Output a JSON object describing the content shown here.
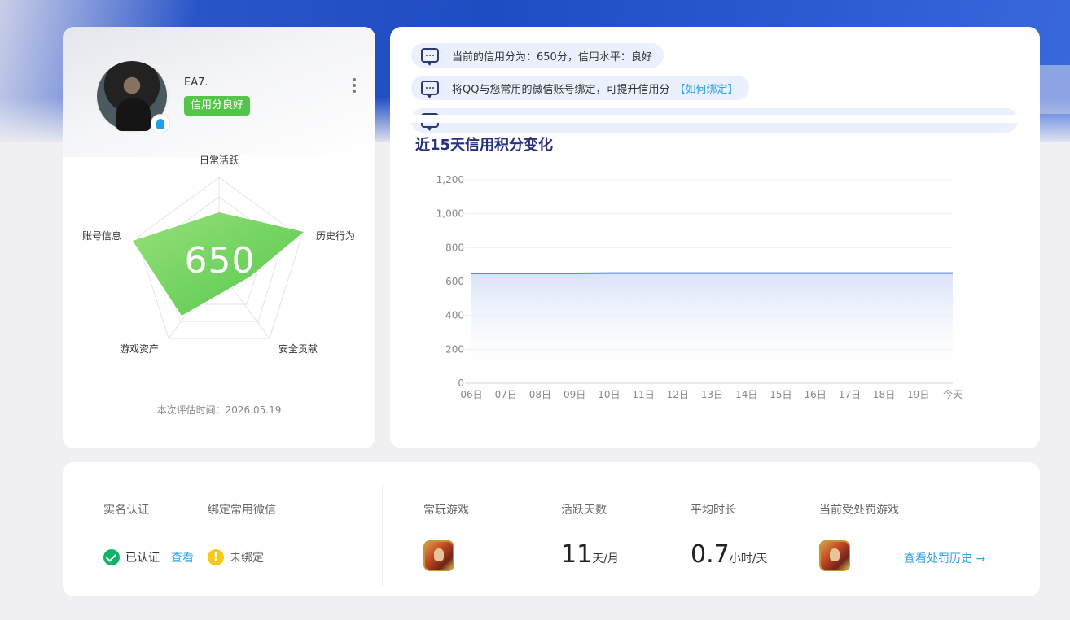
{
  "profile": {
    "username": "EA7.",
    "credit_badge": "信用分良好",
    "score": "650",
    "eval_time": "本次评估时间：2026.05.19",
    "radar_labels": {
      "top": "日常活跃",
      "right": "历史行为",
      "bottom_right": "安全贡献",
      "bottom_left": "游戏资产",
      "left": "账号信息"
    }
  },
  "notices": [
    {
      "text": "当前的信用分为：650分，信用水平：良好",
      "link": ""
    },
    {
      "text": "将QQ与您常用的微信账号绑定，可提升信用分",
      "link": "【如何绑定】"
    }
  ],
  "chart_data": {
    "type": "area",
    "title": "近15天信用积分变化",
    "categories": [
      "06日",
      "07日",
      "08日",
      "09日",
      "10日",
      "11日",
      "12日",
      "13日",
      "14日",
      "15日",
      "16日",
      "17日",
      "18日",
      "19日",
      "今天"
    ],
    "series": [
      {
        "values": [
          648,
          648,
          648,
          648,
          650,
          650,
          650,
          650,
          650,
          650,
          650,
          650,
          650,
          650,
          650
        ]
      }
    ],
    "ylim": [
      0,
      1200
    ],
    "yticks": [
      "0",
      "200",
      "400",
      "600",
      "800",
      "1,000",
      "1,200"
    ],
    "colors": {
      "line": "#5b87d6",
      "fill_top": "#d9e3f8"
    }
  },
  "stats": {
    "real_name_head": "实名认证",
    "wechat_head": "绑定常用微信",
    "verified": "已认证",
    "view": "查看",
    "unbound": "未绑定",
    "fav_game_head": "常玩游戏",
    "active_days_head": "活跃天数",
    "active_days_value": "11",
    "active_days_unit": "天/月",
    "avg_time_head": "平均时长",
    "avg_time_value": "0.7",
    "avg_time_unit": "小时/天",
    "penalty_head": "当前受处罚游戏",
    "penalty_link": "查看处罚历史 →"
  }
}
